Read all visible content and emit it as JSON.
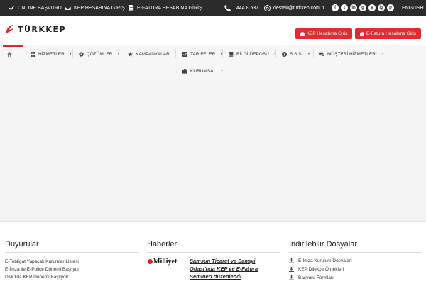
{
  "topbar": {
    "online_basvuru": "ONLINE BAŞVURU",
    "kep_giris": "KEP HESABINA GİRİŞ",
    "efatura_giris": "E-FATURA HESABINA GİRİŞ",
    "phone": "444 8 537",
    "email": "destek@turkkep.com.tr",
    "language": "ENGLISH",
    "social": [
      "f",
      "t",
      "in",
      "g",
      "y",
      "ig",
      "p"
    ]
  },
  "header": {
    "logo_text": "TÜRKKEP",
    "kep_button": "KEP Hesabına Giriş",
    "efatura_button": "E-Fatura Hesabına Giriş",
    "accent": "#e32b30"
  },
  "nav": {
    "items": [
      {
        "label": "HİZMETLER"
      },
      {
        "label": "ÇÖZÜMLER"
      },
      {
        "label": "KAMPANYALAR"
      },
      {
        "label": "TARİFELER"
      },
      {
        "label": "BİLGİ DEPOSU"
      },
      {
        "label": "S.S.S."
      },
      {
        "label": "MÜŞTERİ HİZMETLERİ"
      },
      {
        "label": "KURUMSAL"
      }
    ]
  },
  "sections": {
    "duyurular": {
      "title": "Duyurular",
      "items": [
        "E-Tebligat Yapacak Kurumlar Listesi",
        "E-İmza ile E-Poliçe Dönemi Başlıyor!",
        "DMO'da KEP Dönemi Başlıyor!"
      ]
    },
    "haberler": {
      "title": "Haberler",
      "source": "Milliyet",
      "headline": "Samsun Ticaret ve Sanayi Odası'nda KEP ve E-Fatura Semineri düzenlendi"
    },
    "indirilebilir": {
      "title": "İndirilebilir Dosyalar",
      "items": [
        "E-İmza Kurulum Dosyaları",
        "KEP Dilekçe Örnekleri",
        "Başvuru Formları"
      ]
    }
  }
}
